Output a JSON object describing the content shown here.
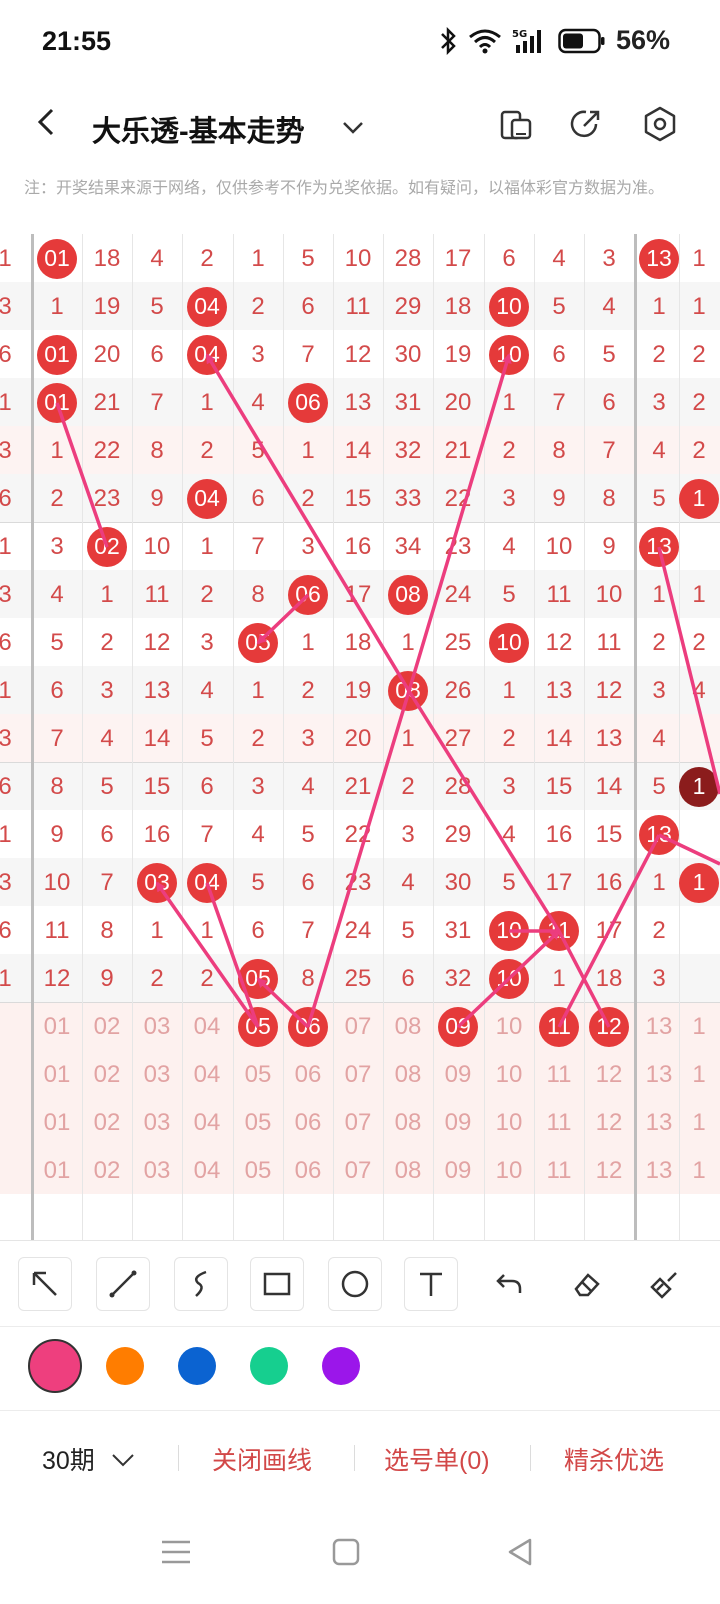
{
  "status": {
    "time": "21:55",
    "battery": "56%",
    "network": "5G"
  },
  "header": {
    "title": "大乐透-基本走势",
    "icons": [
      "back-icon",
      "chevron-down-icon",
      "device-icon",
      "share-icon",
      "settings-icon"
    ]
  },
  "notice": "注：开奖结果来源于网络，仅供参考不作为兑奖依据。如有疑问，以福体彩官方数据为准。",
  "grid": {
    "col_centers": [
      5,
      57,
      107,
      157,
      207,
      258,
      308,
      358,
      408,
      458,
      509,
      559,
      609,
      659,
      699
    ],
    "rows": [
      {
        "cells": [
          "1",
          "01",
          "18",
          "4",
          "2",
          "1",
          "5",
          "10",
          "28",
          "17",
          "6",
          "4",
          "3",
          "13",
          "1"
        ],
        "hits": [
          1,
          13
        ]
      },
      {
        "cells": [
          "3",
          "1",
          "19",
          "5",
          "04",
          "2",
          "6",
          "11",
          "29",
          "18",
          "10",
          "5",
          "4",
          "1",
          "1"
        ],
        "hits": [
          4,
          10
        ]
      },
      {
        "cells": [
          "6",
          "01",
          "20",
          "6",
          "04",
          "3",
          "7",
          "12",
          "30",
          "19",
          "10",
          "6",
          "5",
          "2",
          "2"
        ],
        "hits": [
          1,
          4,
          10
        ]
      },
      {
        "cells": [
          "1",
          "01",
          "21",
          "7",
          "1",
          "4",
          "06",
          "13",
          "31",
          "20",
          "1",
          "7",
          "6",
          "3",
          "2"
        ],
        "hits": [
          1,
          6
        ]
      },
      {
        "cells": [
          "3",
          "1",
          "22",
          "8",
          "2",
          "5",
          "1",
          "14",
          "32",
          "21",
          "2",
          "8",
          "7",
          "4",
          "2"
        ],
        "hits": []
      },
      {
        "cells": [
          "6",
          "2",
          "23",
          "9",
          "04",
          "6",
          "2",
          "15",
          "33",
          "22",
          "3",
          "9",
          "8",
          "5",
          "1"
        ],
        "hits": [
          4,
          14
        ]
      },
      {
        "cells": [
          "1",
          "3",
          "02",
          "10",
          "1",
          "7",
          "3",
          "16",
          "34",
          "23",
          "4",
          "10",
          "9",
          "13",
          ""
        ],
        "hits": [
          2,
          13
        ]
      },
      {
        "cells": [
          "3",
          "4",
          "1",
          "11",
          "2",
          "8",
          "06",
          "17",
          "08",
          "24",
          "5",
          "11",
          "10",
          "1",
          "1"
        ],
        "hits": [
          6,
          8
        ]
      },
      {
        "cells": [
          "6",
          "5",
          "2",
          "12",
          "3",
          "05",
          "1",
          "18",
          "1",
          "25",
          "10",
          "12",
          "11",
          "2",
          "2"
        ],
        "hits": [
          5,
          10
        ]
      },
      {
        "cells": [
          "1",
          "6",
          "3",
          "13",
          "4",
          "1",
          "2",
          "19",
          "08",
          "26",
          "1",
          "13",
          "12",
          "3",
          "4"
        ],
        "hits": [
          8
        ]
      },
      {
        "cells": [
          "3",
          "7",
          "4",
          "14",
          "5",
          "2",
          "3",
          "20",
          "1",
          "27",
          "2",
          "14",
          "13",
          "4",
          ""
        ],
        "hits": []
      },
      {
        "cells": [
          "6",
          "8",
          "5",
          "15",
          "6",
          "3",
          "4",
          "21",
          "2",
          "28",
          "3",
          "15",
          "14",
          "5",
          "1"
        ],
        "hits": [
          14
        ]
      },
      {
        "cells": [
          "1",
          "9",
          "6",
          "16",
          "7",
          "4",
          "5",
          "22",
          "3",
          "29",
          "4",
          "16",
          "15",
          "13",
          ""
        ],
        "hits": [
          13
        ]
      },
      {
        "cells": [
          "3",
          "10",
          "7",
          "03",
          "04",
          "5",
          "6",
          "23",
          "4",
          "30",
          "5",
          "17",
          "16",
          "1",
          "1"
        ],
        "hits": [
          3,
          4,
          14
        ]
      },
      {
        "cells": [
          "6",
          "11",
          "8",
          "1",
          "1",
          "6",
          "7",
          "24",
          "5",
          "31",
          "10",
          "11",
          "17",
          "2",
          ""
        ],
        "hits": [
          10,
          11
        ]
      },
      {
        "cells": [
          "1",
          "12",
          "9",
          "2",
          "2",
          "05",
          "8",
          "25",
          "6",
          "32",
          "10",
          "1",
          "18",
          "3",
          ""
        ],
        "hits": [
          5,
          10
        ]
      },
      {
        "cells": [
          "",
          "01",
          "02",
          "03",
          "04",
          "05",
          "06",
          "07",
          "08",
          "09",
          "10",
          "11",
          "12",
          "13",
          "1"
        ],
        "hits": [
          5,
          6,
          9,
          11,
          12
        ],
        "faded": true
      },
      {
        "cells": [
          "",
          "01",
          "02",
          "03",
          "04",
          "05",
          "06",
          "07",
          "08",
          "09",
          "10",
          "11",
          "12",
          "13",
          "1"
        ],
        "hits": [],
        "faded": true
      },
      {
        "cells": [
          "",
          "01",
          "02",
          "03",
          "04",
          "05",
          "06",
          "07",
          "08",
          "09",
          "10",
          "11",
          "12",
          "13",
          "1"
        ],
        "hits": [],
        "faded": true
      },
      {
        "cells": [
          "",
          "01",
          "02",
          "03",
          "04",
          "05",
          "06",
          "07",
          "08",
          "09",
          "10",
          "11",
          "12",
          "13",
          "1"
        ],
        "hits": [],
        "faded": true
      }
    ]
  },
  "tools": [
    "arrow-tool",
    "line-tool",
    "freehand-tool",
    "rectangle-tool",
    "circle-tool",
    "text-tool",
    "undo-tool",
    "eraser-tool",
    "clear-tool"
  ],
  "colors": [
    "#ee3f7e",
    "#ff7d00",
    "#0b63d1",
    "#16cf8f",
    "#9b16ea"
  ],
  "bottom": {
    "period": "30期",
    "close_lines": "关闭画线",
    "selection": "选号单(0)",
    "premium": "精杀优选"
  }
}
